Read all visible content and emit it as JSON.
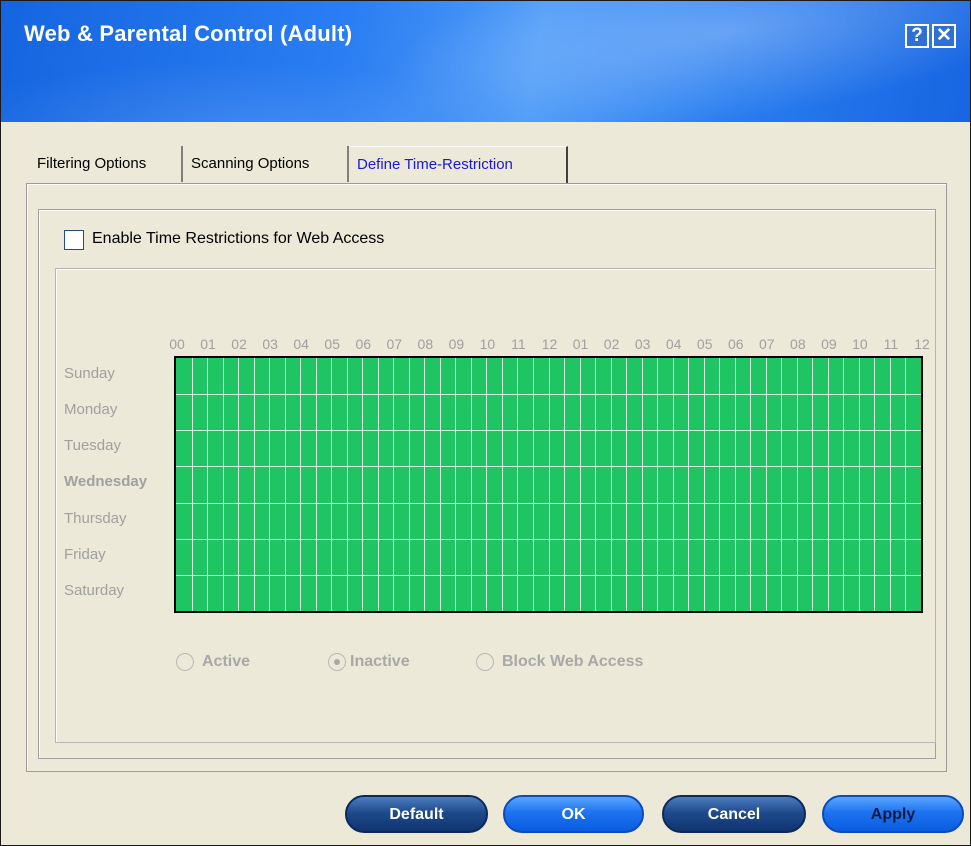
{
  "window": {
    "title": "Web & Parental Control (Adult)",
    "help_label": "?",
    "close_label": "✕"
  },
  "tabs": [
    {
      "label": "Filtering Options",
      "active": false
    },
    {
      "label": "Scanning Options",
      "active": false
    },
    {
      "label": "Define Time-Restriction",
      "active": true
    }
  ],
  "enable_restrictions": {
    "label": "Enable Time Restrictions for Web Access",
    "checked": false
  },
  "schedule": {
    "hour_labels": [
      "00",
      "01",
      "02",
      "03",
      "04",
      "05",
      "06",
      "07",
      "08",
      "09",
      "10",
      "11",
      "12",
      "01",
      "02",
      "03",
      "04",
      "05",
      "06",
      "07",
      "08",
      "09",
      "10",
      "11",
      "12"
    ],
    "days": [
      "Sunday",
      "Monday",
      "Tuesday",
      "Wednesday",
      "Thursday",
      "Friday",
      "Saturday"
    ],
    "highlighted_day": "Wednesday",
    "cell_state": "Active",
    "cell_color": "#1fc563"
  },
  "legend": {
    "options": [
      {
        "label": "Active",
        "selected": false
      },
      {
        "label": "Inactive",
        "selected": true
      },
      {
        "label": "Block Web Access",
        "selected": false
      }
    ],
    "enabled": false
  },
  "buttons": {
    "default_label": "Default",
    "ok_label": "OK",
    "cancel_label": "Cancel",
    "apply_label": "Apply"
  }
}
